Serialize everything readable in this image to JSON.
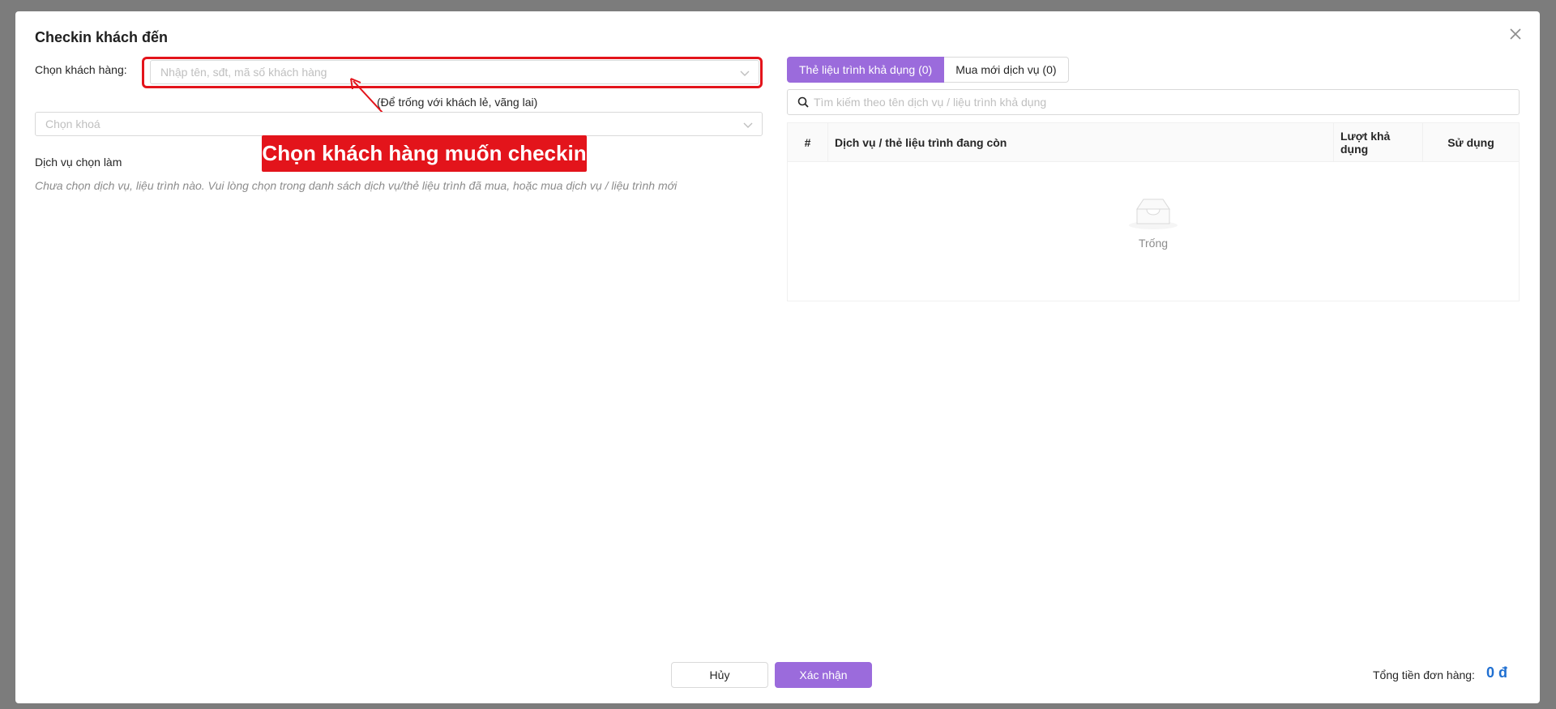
{
  "dialog": {
    "title": "Checkin khách đến",
    "close_icon": "close-icon"
  },
  "left": {
    "customer_label": "Chọn khách hàng:",
    "customer_placeholder": "Nhập tên, sđt, mã số khách hàng",
    "customer_hint": "(Để trống với khách lẻ, vãng lai)",
    "course_placeholder": "Chọn khoá",
    "services_label": "Dịch vụ chọn làm",
    "services_empty_note": "Chưa chọn dịch vụ, liệu trình nào. Vui lòng chọn trong danh sách dịch vụ/thẻ liệu trình đã mua, hoặc mua dịch vụ / liệu trình mới"
  },
  "annotation": {
    "text": "Chọn khách hàng muốn checkin",
    "color": "#e3141b"
  },
  "right": {
    "tabs": [
      {
        "label": "Thẻ liệu trình khả dụng (0)",
        "active": true
      },
      {
        "label": "Mua mới dịch vụ (0)",
        "active": false
      }
    ],
    "search_placeholder": "Tìm kiếm theo tên dịch vụ / liệu trình khả dụng",
    "table": {
      "columns": [
        "#",
        "Dịch vụ / thẻ liệu trình đang còn",
        "Lượt khả dụng",
        "Sử dụng"
      ],
      "rows": [],
      "empty_text": "Trống"
    }
  },
  "footer": {
    "cancel_label": "Hủy",
    "confirm_label": "Xác nhận",
    "total_label": "Tổng tiền đơn hàng:",
    "total_value": "0 đ"
  },
  "colors": {
    "accent": "#9b6bdc",
    "total": "#1f6fd1"
  }
}
